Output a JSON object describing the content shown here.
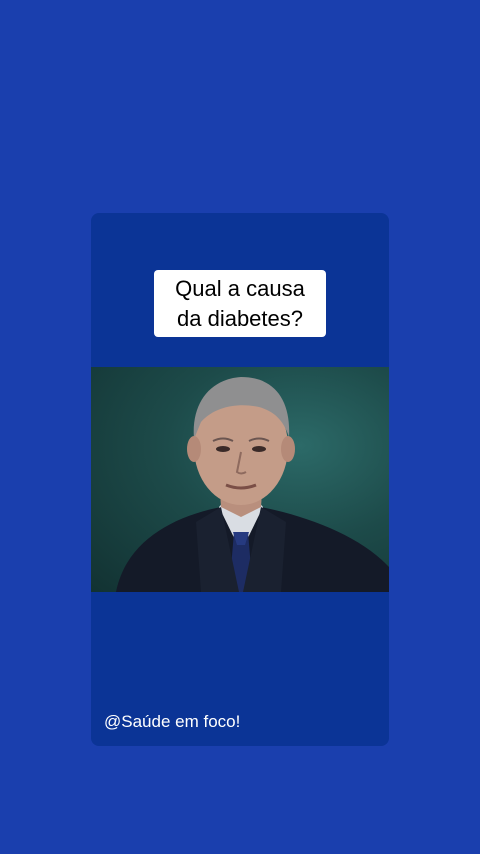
{
  "post": {
    "question": "Qual a causa\nda diabetes?",
    "handle": "@Saúde em foco!"
  },
  "colors": {
    "background": "#1a3fae",
    "card": "#0b3496",
    "video_bg": "#1d4b4a",
    "caption_bg": "#ffffff"
  }
}
